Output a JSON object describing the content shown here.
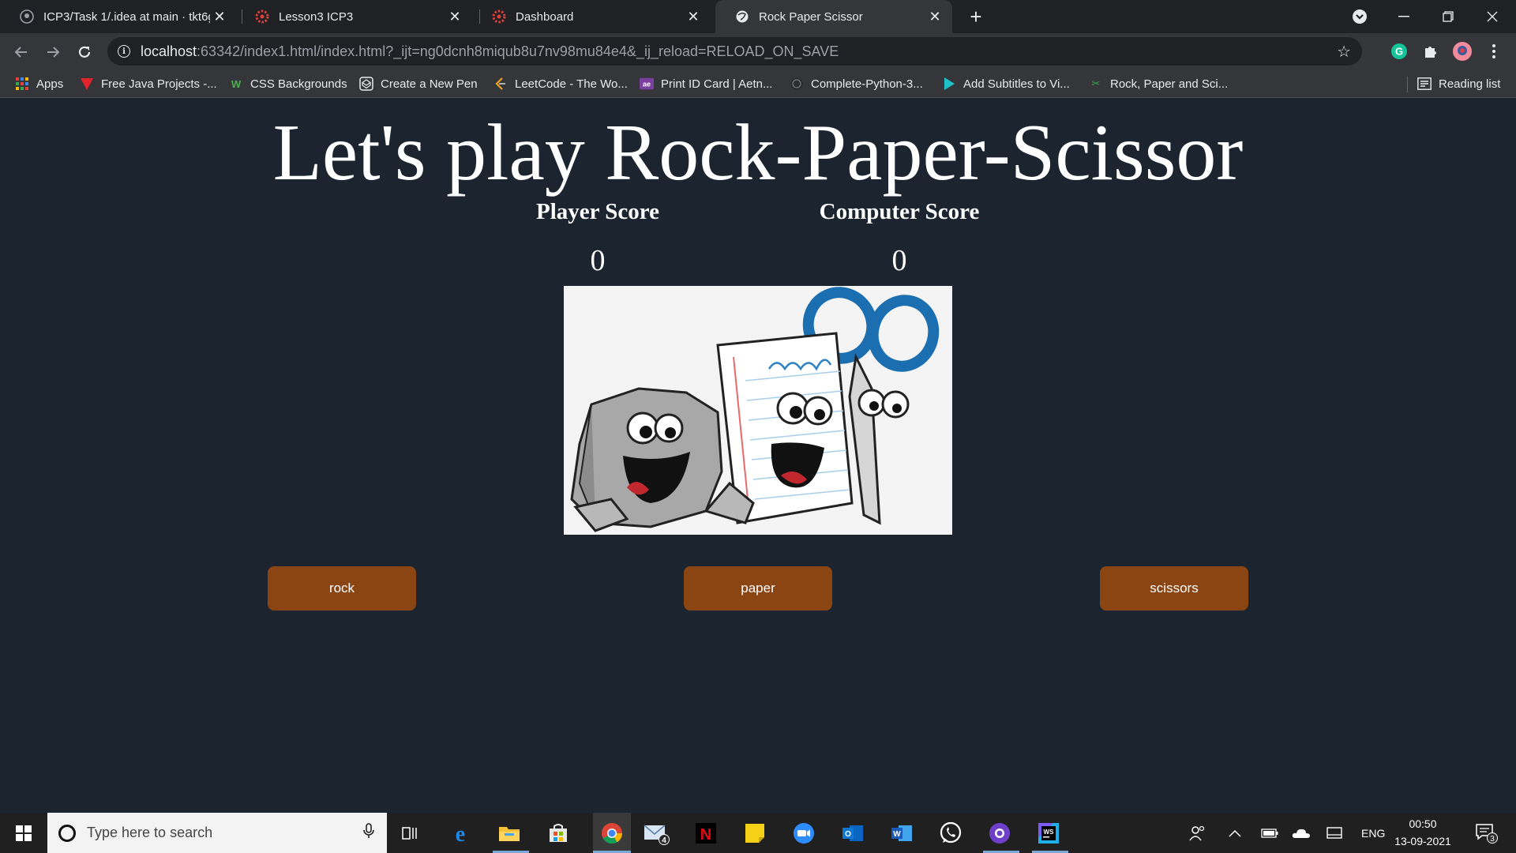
{
  "browser": {
    "tabs": [
      {
        "title": "ICP3/Task 1/.idea at main · tkt6g/",
        "icon": "github-icon"
      },
      {
        "title": "Lesson3 ICP3",
        "icon": "settings-gear-icon"
      },
      {
        "title": "Dashboard",
        "icon": "settings-gear-icon"
      },
      {
        "title": "Rock Paper Scissor",
        "icon": "globe-icon"
      }
    ],
    "new_tab": "+",
    "url_host": "localhost",
    "url_rest": ":63342/index1.html/index.html?_ijt=ng0dcnh8miqub8u7nv98mu84e4&_ij_reload=RELOAD_ON_SAVE",
    "bookmarks": [
      {
        "label": "Apps",
        "icon": "apps-grid-icon"
      },
      {
        "label": "Free Java Projects -...",
        "icon": "red-v-icon"
      },
      {
        "label": "CSS Backgrounds",
        "icon": "w-logo-icon"
      },
      {
        "label": "Create a New Pen",
        "icon": "codepen-icon"
      },
      {
        "label": "LeetCode - The Wo...",
        "icon": "leetcode-icon"
      },
      {
        "label": "Print ID Card | Aetn...",
        "icon": "id-card-icon"
      },
      {
        "label": "Complete-Python-3...",
        "icon": "github-icon"
      },
      {
        "label": "Add Subtitles to Vi...",
        "icon": "play-icon"
      },
      {
        "label": "Rock, Paper and Sci...",
        "icon": "scissors-icon"
      }
    ],
    "reading_list": "Reading list"
  },
  "page": {
    "heading": "Let's play Rock-Paper-Scissor",
    "player_label": "Player Score",
    "computer_label": "Computer Score",
    "player_score": "0",
    "computer_score": "0",
    "buttons": {
      "rock": "rock",
      "paper": "paper",
      "scissors": "scissors"
    },
    "button_color": "#8b4513",
    "background_color": "#1c2430"
  },
  "taskbar": {
    "search_placeholder": "Type here to search",
    "mail_badge": "4",
    "language": "ENG",
    "time": "00:50",
    "date": "13-09-2021",
    "notification_count": "3"
  }
}
